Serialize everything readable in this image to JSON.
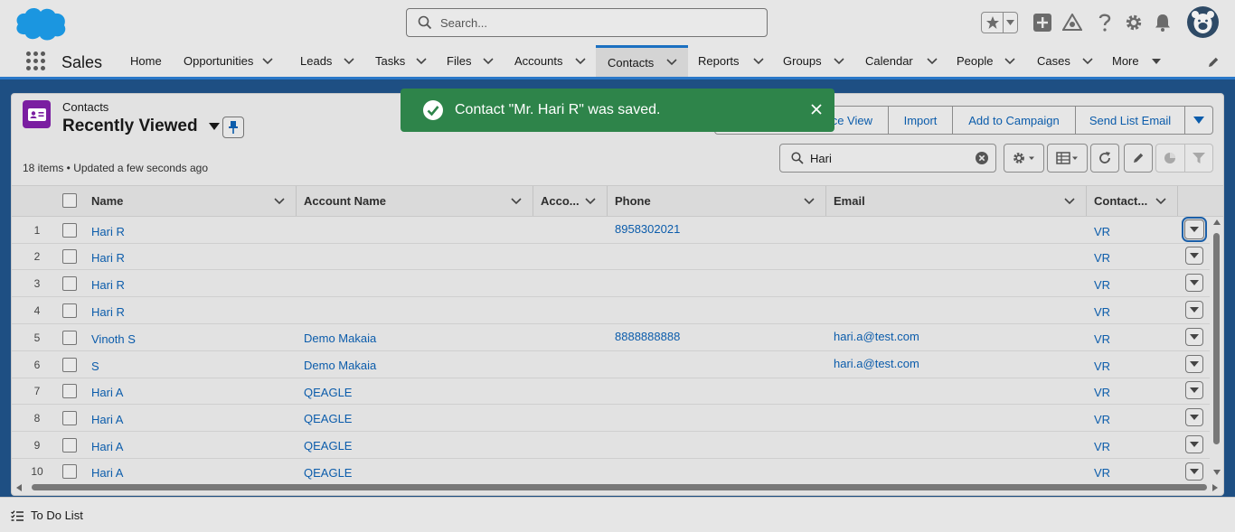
{
  "header": {
    "search_placeholder": "Search..."
  },
  "nav": {
    "app_name": "Sales",
    "items": [
      {
        "label": "Home",
        "has_menu": false
      },
      {
        "label": "Opportunities",
        "has_menu": true
      },
      {
        "label": "Leads",
        "has_menu": true
      },
      {
        "label": "Tasks",
        "has_menu": true
      },
      {
        "label": "Files",
        "has_menu": true
      },
      {
        "label": "Accounts",
        "has_menu": true
      },
      {
        "label": "Contacts",
        "has_menu": true,
        "active": true
      },
      {
        "label": "Reports",
        "has_menu": true
      },
      {
        "label": "Groups",
        "has_menu": true
      },
      {
        "label": "Calendar",
        "has_menu": true
      },
      {
        "label": "People",
        "has_menu": true
      },
      {
        "label": "Cases",
        "has_menu": true
      },
      {
        "label": "More",
        "has_menu": true
      }
    ]
  },
  "list_view": {
    "object_label": "Contacts",
    "title": "Recently Viewed",
    "meta": "18 items • Updated a few seconds ago",
    "buttons": {
      "intelligence_view_partial": "ce View",
      "import": "Import",
      "add_to_campaign": "Add to Campaign",
      "send_list_email": "Send List Email"
    },
    "search_value": "Hari"
  },
  "table": {
    "columns": [
      "Name",
      "Account Name",
      "Acco...",
      "Phone",
      "Email",
      "Contact..."
    ],
    "rows": [
      {
        "num": "1",
        "name": "Hari R",
        "account": "",
        "phone": "8958302021",
        "email": "",
        "owner": "VR"
      },
      {
        "num": "2",
        "name": "Hari R",
        "account": "",
        "phone": "",
        "email": "",
        "owner": "VR"
      },
      {
        "num": "3",
        "name": "Hari R",
        "account": "",
        "phone": "",
        "email": "",
        "owner": "VR"
      },
      {
        "num": "4",
        "name": "Hari R",
        "account": "",
        "phone": "",
        "email": "",
        "owner": "VR"
      },
      {
        "num": "5",
        "name": "Vinoth S",
        "account": "Demo Makaia",
        "phone": "8888888888",
        "email": "hari.a@test.com",
        "owner": "VR"
      },
      {
        "num": "6",
        "name": "S",
        "account": "Demo Makaia",
        "phone": "",
        "email": "hari.a@test.com",
        "owner": "VR"
      },
      {
        "num": "7",
        "name": "Hari A",
        "account": "QEAGLE",
        "phone": "",
        "email": "",
        "owner": "VR"
      },
      {
        "num": "8",
        "name": "Hari A",
        "account": "QEAGLE",
        "phone": "",
        "email": "",
        "owner": "VR"
      },
      {
        "num": "9",
        "name": "Hari A",
        "account": "QEAGLE",
        "phone": "",
        "email": "",
        "owner": "VR"
      },
      {
        "num": "10",
        "name": "Hari A",
        "account": "QEAGLE",
        "phone": "",
        "email": "",
        "owner": "VR"
      }
    ]
  },
  "toast": {
    "message": "Contact \"Mr. Hari R\" was saved."
  },
  "utility_bar": {
    "todo_label": "To Do List"
  },
  "colors": {
    "brand_blue": "#0b5cab",
    "toast_green": "#2e844a",
    "contacts_icon": "#7a1ea1",
    "page_backdrop": "#1e4f83"
  }
}
